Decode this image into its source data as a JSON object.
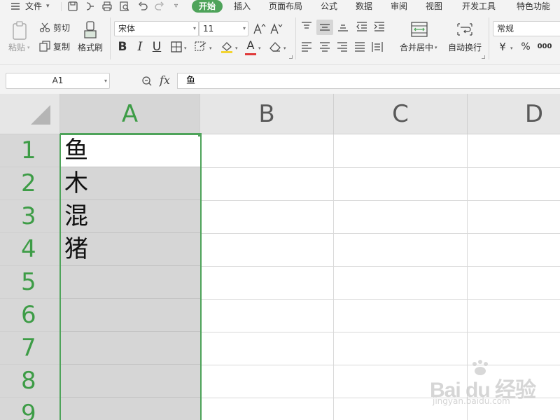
{
  "menubar": {
    "file_label": "文件",
    "tabs": [
      "开始",
      "插入",
      "页面布局",
      "公式",
      "数据",
      "审阅",
      "视图",
      "开发工具",
      "特色功能"
    ]
  },
  "ribbon": {
    "paste_label": "粘贴",
    "cut_label": "剪切",
    "copy_label": "复制",
    "format_painter_label": "格式刷",
    "font_name": "宋体",
    "font_size": "11",
    "bold": "B",
    "italic": "I",
    "underline": "U",
    "font_color_glyph": "A",
    "merge_center_label": "合并居中",
    "wrap_text_label": "自动换行",
    "number_format": "常规",
    "currency_symbol": "¥",
    "percent_symbol": "%",
    "thousands_glyph": "000"
  },
  "formula_bar": {
    "cell_ref": "A1",
    "fx_label": "fx",
    "content": "鱼"
  },
  "grid": {
    "columns": [
      "A",
      "B",
      "C",
      "D"
    ],
    "selected_column": "A",
    "rows": [
      "1",
      "2",
      "3",
      "4",
      "5",
      "6",
      "7",
      "8",
      "9"
    ],
    "column_a_values": [
      "鱼",
      "木",
      "混",
      "猪",
      "",
      "",
      "",
      "",
      ""
    ]
  },
  "watermark": {
    "logo_text": "Bai du 经验",
    "sub_text": "jingyan.baidu.com"
  },
  "colors": {
    "accent_green": "#4ea35a",
    "header_gray": "#e6e6e6",
    "selection_gray": "#d6d6d6"
  }
}
